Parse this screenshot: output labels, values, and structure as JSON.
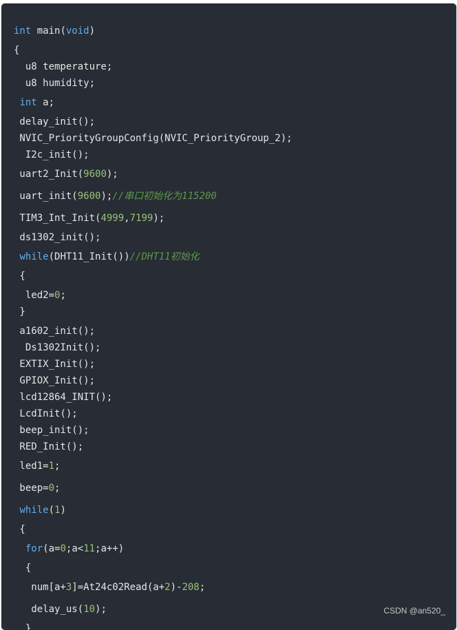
{
  "code": {
    "lines": [
      [
        {
          "t": "int",
          "c": "kw"
        },
        {
          "t": " main("
        },
        {
          "t": "void",
          "c": "kw"
        },
        {
          "t": ")"
        }
      ],
      [
        {
          "t": "{"
        }
      ],
      [
        {
          "t": "  u8 temperature;"
        }
      ],
      [
        {
          "t": "  u8 humidity;"
        }
      ],
      [
        {
          "t": " "
        },
        {
          "t": "int",
          "c": "kw"
        },
        {
          "t": " a;"
        }
      ],
      [
        {
          "t": " delay_init();"
        }
      ],
      [
        {
          "t": " NVIC_PriorityGroupConfig(NVIC_PriorityGroup_2);"
        }
      ],
      [
        {
          "t": "  I2c_init();"
        }
      ],
      [
        {
          "t": " uart2_Init("
        },
        {
          "t": "9600",
          "c": "num"
        },
        {
          "t": ");"
        }
      ],
      [
        {
          "t": " uart_init("
        },
        {
          "t": "9600",
          "c": "num"
        },
        {
          "t": ");"
        },
        {
          "t": "//串口初始化为115200",
          "c": "cmt"
        }
      ],
      [
        {
          "t": " TIM3_Int_Init("
        },
        {
          "t": "4999",
          "c": "num"
        },
        {
          "t": ","
        },
        {
          "t": "7199",
          "c": "num"
        },
        {
          "t": ");"
        }
      ],
      [
        {
          "t": " ds1302_init();"
        }
      ],
      [
        {
          "t": " "
        },
        {
          "t": "while",
          "c": "kw"
        },
        {
          "t": "(DHT11_Init())"
        },
        {
          "t": "//DHT11初始化",
          "c": "cmt"
        }
      ],
      [
        {
          "t": " {"
        }
      ],
      [
        {
          "t": "  led2="
        },
        {
          "t": "0",
          "c": "num"
        },
        {
          "t": ";"
        }
      ],
      [
        {
          "t": " }"
        }
      ],
      [
        {
          "t": " a1602_init();"
        }
      ],
      [
        {
          "t": "  Ds1302Init();"
        }
      ],
      [
        {
          "t": " EXTIX_Init();"
        }
      ],
      [
        {
          "t": " GPIOX_Init();"
        }
      ],
      [
        {
          "t": " lcd12864_INIT();"
        }
      ],
      [
        {
          "t": " LcdInit();"
        }
      ],
      [
        {
          "t": " beep_init();"
        }
      ],
      [
        {
          "t": " RED_Init();"
        }
      ],
      [
        {
          "t": " led1="
        },
        {
          "t": "1",
          "c": "num"
        },
        {
          "t": ";"
        }
      ],
      [
        {
          "t": " beep="
        },
        {
          "t": "0",
          "c": "num"
        },
        {
          "t": ";"
        }
      ],
      [
        {
          "t": " "
        },
        {
          "t": "while",
          "c": "kw"
        },
        {
          "t": "("
        },
        {
          "t": "1",
          "c": "num"
        },
        {
          "t": ")"
        }
      ],
      [
        {
          "t": " {"
        }
      ],
      [
        {
          "t": "  "
        },
        {
          "t": "for",
          "c": "kw"
        },
        {
          "t": "(a="
        },
        {
          "t": "0",
          "c": "num"
        },
        {
          "t": ";a<"
        },
        {
          "t": "11",
          "c": "num"
        },
        {
          "t": ";a++)"
        }
      ],
      [
        {
          "t": "  {"
        }
      ],
      [
        {
          "t": "   num[a+"
        },
        {
          "t": "3",
          "c": "num"
        },
        {
          "t": "]=At24c02Read(a+"
        },
        {
          "t": "2",
          "c": "num"
        },
        {
          "t": ")-"
        },
        {
          "t": "208",
          "c": "num"
        },
        {
          "t": ";"
        }
      ],
      [
        {
          "t": "   delay_us("
        },
        {
          "t": "10",
          "c": "num"
        },
        {
          "t": ");"
        }
      ],
      [
        {
          "t": "  }"
        }
      ]
    ]
  },
  "watermark": "CSDN @an520_"
}
